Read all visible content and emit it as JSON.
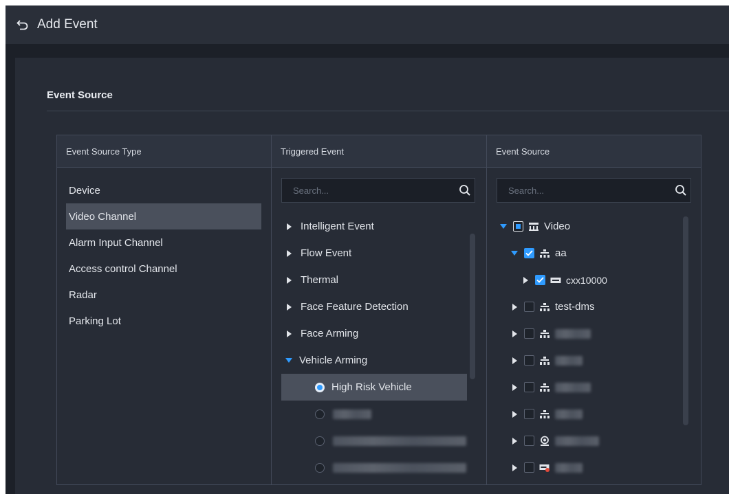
{
  "header": {
    "title": "Add Event",
    "back_icon": "back-arrow-icon"
  },
  "section": {
    "title": "Event Source"
  },
  "columns": {
    "source_type": "Event Source Type",
    "triggered_event": "Triggered Event",
    "event_source": "Event Source"
  },
  "source_types": [
    {
      "label": "Device",
      "selected": false
    },
    {
      "label": "Video Channel",
      "selected": true
    },
    {
      "label": "Alarm Input Channel",
      "selected": false
    },
    {
      "label": "Access control Channel",
      "selected": false
    },
    {
      "label": "Radar",
      "selected": false
    },
    {
      "label": "Parking Lot",
      "selected": false
    }
  ],
  "triggered_search": {
    "placeholder": "Search..."
  },
  "triggered_events": [
    {
      "label": "Intelligent Event",
      "expanded": false
    },
    {
      "label": "Flow Event",
      "expanded": false
    },
    {
      "label": "Thermal",
      "expanded": false
    },
    {
      "label": "Face Feature Detection",
      "expanded": false
    },
    {
      "label": "Face Arming",
      "expanded": false
    },
    {
      "label": "Vehicle Arming",
      "expanded": true
    }
  ],
  "vehicle_arming_children": [
    {
      "label": "High Risk Vehicle",
      "selected": true
    },
    {
      "label": "",
      "selected": false,
      "redacted": true
    },
    {
      "label": "",
      "selected": false,
      "redacted": true
    },
    {
      "label": "",
      "selected": false,
      "redacted": true
    }
  ],
  "source_search": {
    "placeholder": "Search..."
  },
  "source_tree": [
    {
      "label": "Video",
      "level": 0,
      "expanded": true,
      "check": "partial",
      "icon": "video-tree-icon"
    },
    {
      "label": "aa",
      "level": 1,
      "expanded": true,
      "check": "checked",
      "icon": "org-node-icon"
    },
    {
      "label": "cxx10000",
      "level": 2,
      "expanded": false,
      "check": "checked",
      "icon": "device-icon"
    },
    {
      "label": "test-dms",
      "level": 1,
      "expanded": false,
      "check": "none",
      "icon": "org-node-icon"
    },
    {
      "label": "",
      "level": 1,
      "expanded": false,
      "check": "none",
      "icon": "org-node-icon",
      "redacted": true
    },
    {
      "label": "",
      "level": 1,
      "expanded": false,
      "check": "none",
      "icon": "org-node-icon",
      "redacted": true
    },
    {
      "label": "",
      "level": 1,
      "expanded": false,
      "check": "none",
      "icon": "org-node-icon",
      "redacted": true
    },
    {
      "label": "",
      "level": 1,
      "expanded": false,
      "check": "none",
      "icon": "org-node-icon",
      "redacted": true
    },
    {
      "label": "",
      "level": 1,
      "expanded": false,
      "check": "none",
      "icon": "camera-icon",
      "redacted": true
    },
    {
      "label": "",
      "level": 1,
      "expanded": false,
      "check": "none",
      "icon": "nvr-alarm-icon",
      "redacted": true
    }
  ],
  "colors": {
    "accent": "#2f9bff",
    "background": "#1c2028",
    "panel": "#272c36",
    "header": "#2a2f39"
  }
}
